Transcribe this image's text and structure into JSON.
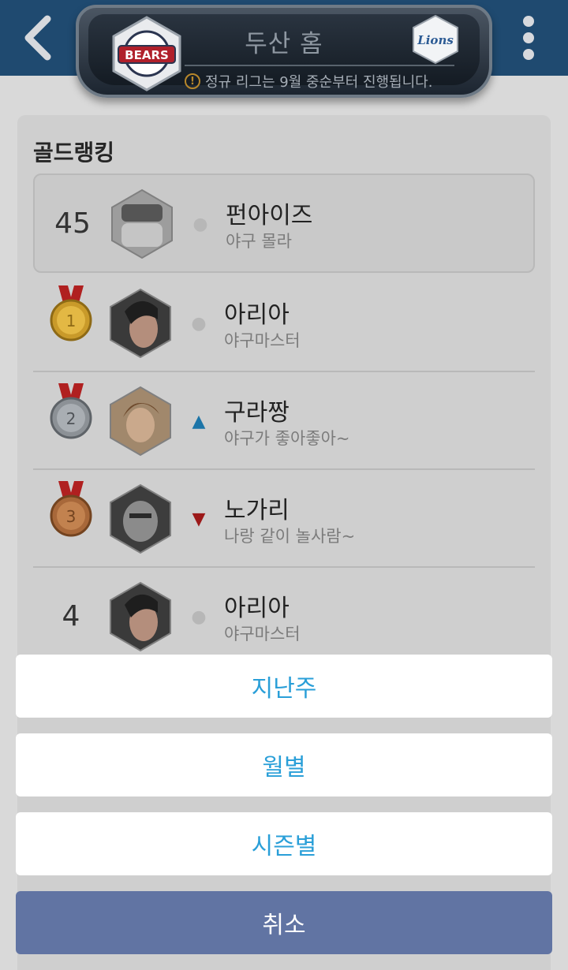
{
  "header": {
    "title": "두산 홈",
    "notice": "정규 리그는 9월 중순부터 진행됩니다.",
    "home_team_logo_text": "BEARS",
    "away_team_logo_text": "Lions"
  },
  "ranking": {
    "title": "골드랭킹",
    "my_rank": {
      "rank": "45",
      "name": "펀아이즈",
      "message": "야구 몰라",
      "trend": "same"
    },
    "rows": [
      {
        "rank": "1",
        "medal": "gold",
        "name": "아리아",
        "message": "야구마스터",
        "trend": "same"
      },
      {
        "rank": "2",
        "medal": "silver",
        "name": "구라짱",
        "message": "야구가 좋아좋아~",
        "trend": "up"
      },
      {
        "rank": "3",
        "medal": "bronze",
        "name": "노가리",
        "message": "나랑 같이 놀사람~",
        "trend": "down"
      },
      {
        "rank": "4",
        "medal": "",
        "name": "아리아",
        "message": "야구마스터",
        "trend": "same"
      }
    ]
  },
  "action_sheet": {
    "options": [
      "지난주",
      "월별",
      "시즌별"
    ],
    "cancel": "취소"
  },
  "colors": {
    "accent": "#2a9fd8",
    "cancel_bg": "#6174a3",
    "trend_up": "#1c75a8",
    "trend_down": "#9c1919"
  },
  "icons": {
    "back": "chevron-left-icon",
    "menu": "more-vertical-icon",
    "notice": "warning-icon"
  }
}
